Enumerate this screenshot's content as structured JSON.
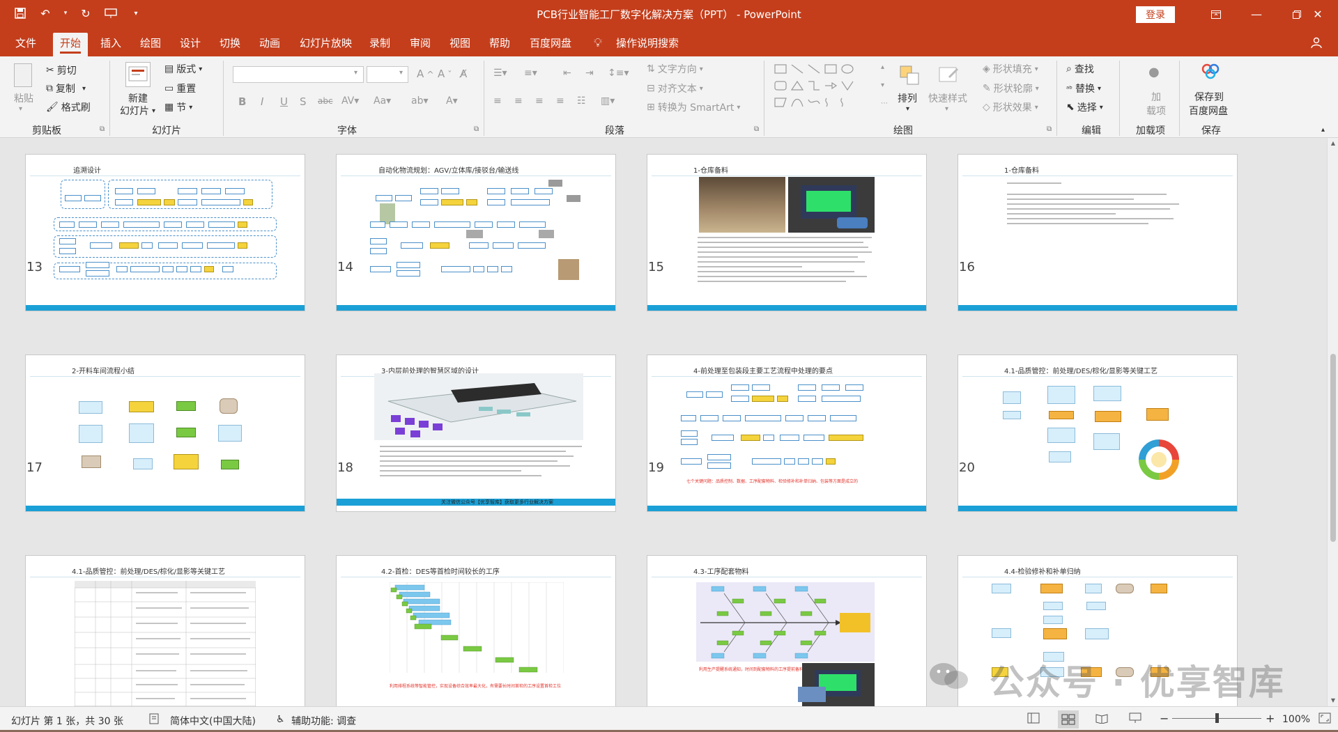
{
  "window": {
    "title": "PCB行业智能工厂数字化解决方案（PPT） - PowerPoint",
    "login_label": "登录",
    "brand_color": "#c43e1c"
  },
  "qat_icons": [
    "save-icon",
    "undo-icon",
    "redo-icon",
    "present-icon",
    "customize-icon"
  ],
  "menu": {
    "tabs": [
      "文件",
      "开始",
      "插入",
      "绘图",
      "设计",
      "切换",
      "动画",
      "幻灯片放映",
      "录制",
      "审阅",
      "视图",
      "帮助",
      "百度网盘"
    ],
    "active_tab": "开始",
    "tell_me": "操作说明搜索"
  },
  "ribbon": {
    "clipboard": {
      "paste": "粘贴",
      "cut": "剪切",
      "copy": "复制",
      "format_painter": "格式刷",
      "label": "剪贴板"
    },
    "slides": {
      "new_slide_1": "新建",
      "new_slide_2": "幻灯片",
      "layout": "版式",
      "reset": "重置",
      "section": "节",
      "label": "幻灯片"
    },
    "font": {
      "label": "字体"
    },
    "paragraph": {
      "text_direction": "文字方向",
      "align_text": "对齐文本",
      "smartart": "转换为 SmartArt",
      "label": "段落"
    },
    "drawing": {
      "arrange": "排列",
      "quick_styles": "快速样式",
      "shape_fill": "形状填充",
      "shape_outline": "形状轮廓",
      "shape_effects": "形状效果",
      "label": "绘图"
    },
    "editing": {
      "find": "查找",
      "replace": "替换",
      "select": "选择",
      "label": "编辑"
    },
    "addins": {
      "addin_1": "加",
      "addin_2": "载项",
      "label": "加载项"
    },
    "save": {
      "save_1": "保存到",
      "save_2": "百度网盘",
      "label": "保存"
    }
  },
  "slides": [
    {
      "number": "13",
      "title": "追溯设计"
    },
    {
      "number": "14",
      "title": "自动化物流规划：AGV/立体库/接驳台/输送线"
    },
    {
      "number": "15",
      "title": "1-仓库备料"
    },
    {
      "number": "16",
      "title": "1-仓库备料"
    },
    {
      "number": "17",
      "title": "2-开料车间流程小结"
    },
    {
      "number": "18",
      "title": "3-内层前处理的智慧区域的设计"
    },
    {
      "number": "19",
      "title": "4-前处理至包装段主要工艺流程中处理的要点"
    },
    {
      "number": "20",
      "title": "4.1-品质管控：前处理/DES/棕化/显影等关键工艺"
    },
    {
      "number": "21",
      "title": "4.1-品质管控：前处理/DES/棕化/显影等关键工艺"
    },
    {
      "number": "22",
      "title": "4.2-首检：DES等首检时间较长的工序"
    },
    {
      "number": "23",
      "title": "4.3-工序配套物料"
    },
    {
      "number": "24",
      "title": "4.4-检验修补和补单归纳"
    }
  ],
  "slide_details": {
    "s15_text": "1-仓库备料",
    "s19_red": "七个关键问题：品质控制、数据、工序配套物料、检验修补和补单归纳、包装等方面是成立的",
    "s22_red": "利用排程系统等智能管控，实现设备综合效率最大化，有需要长时间首检的工序设置首检工位",
    "s23_red": "利用生产提醒系统通知，时间到配套物料的工序提前备料",
    "s18_footer": "关注微信公众号【优享智库】获取更多行业解决方案"
  },
  "watermark": "公众号 · 优享智库",
  "status": {
    "slide_info": "幻灯片 第 1 张，共 30 张",
    "language": "简体中文(中国大陆)",
    "accessibility": "辅助功能: 调查",
    "zoom": "100%"
  }
}
